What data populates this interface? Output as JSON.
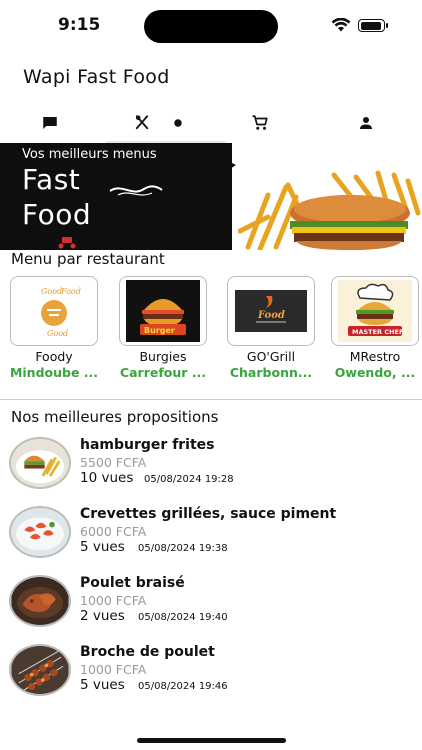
{
  "status": {
    "time": "9:15"
  },
  "app": {
    "title": "Wapi Fast Food"
  },
  "tabs": [
    {
      "icon": "chat-icon"
    },
    {
      "icon": "utensils-icon"
    },
    {
      "icon": "dot-icon"
    },
    {
      "icon": "cart-icon"
    },
    {
      "icon": "person-icon"
    }
  ],
  "banner": {
    "tagline": "Vos meilleurs menus",
    "line1": "Fast",
    "line2": "Food"
  },
  "restaurants_section": {
    "title": "Menu par restaurant",
    "items": [
      {
        "name": "Foody",
        "location": "Mindoube ...",
        "logo_text_1": "Good",
        "logo_text_2": "Food",
        "logo_text_3": "Good"
      },
      {
        "name": "Burgies",
        "location": "Carrefour ...",
        "logo_text_1": "Burger"
      },
      {
        "name": "GO'Grill",
        "location": "Charbonn...",
        "logo_text_1": "Food"
      },
      {
        "name": "MRestro",
        "location": "Owendo, ...",
        "logo_text_1": "MASTER CHEF"
      }
    ]
  },
  "proposals_section": {
    "title": "Nos meilleures propositions",
    "items": [
      {
        "name": "hamburger frites",
        "price": "5500 FCFA",
        "views": "10 vues",
        "date": "05/08/2024 19:28"
      },
      {
        "name": "Crevettes grillées, sauce piment",
        "price": "6000 FCFA",
        "views": "5 vues",
        "date": "05/08/2024 19:38"
      },
      {
        "name": "Poulet braisé",
        "price": "1000 FCFA",
        "views": "2 vues",
        "date": "05/08/2024 19:40"
      },
      {
        "name": "Broche de poulet",
        "price": "1000 FCFA",
        "views": "5 vues",
        "date": "05/08/2024 19:46"
      }
    ]
  },
  "colors": {
    "accent_green": "#3aa53f",
    "banner_dark": "#0e0e0e",
    "price_grey": "#9a9a9a"
  }
}
